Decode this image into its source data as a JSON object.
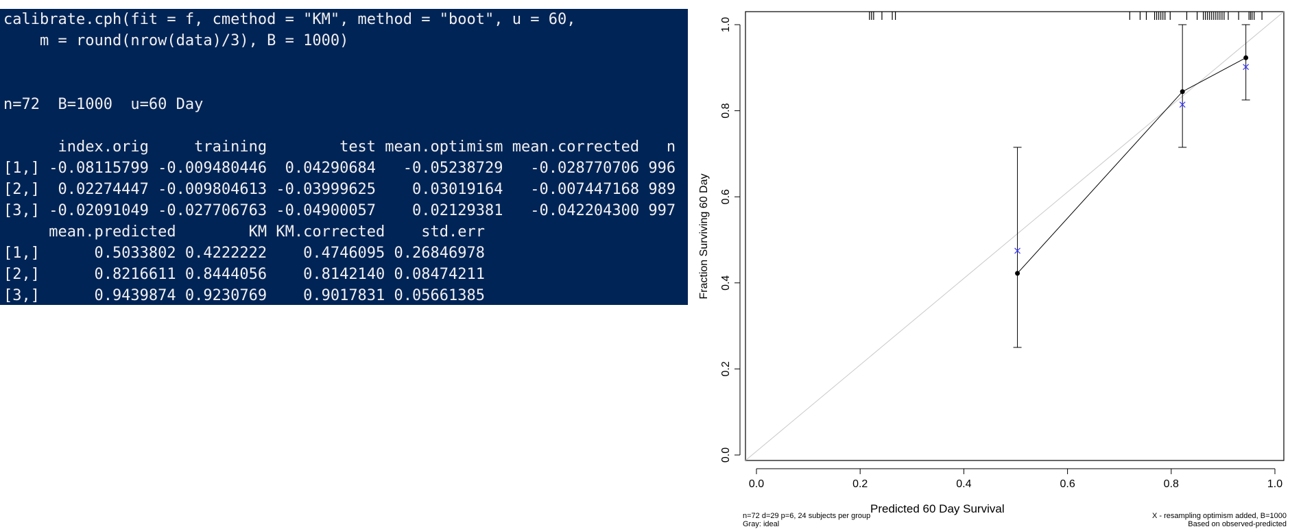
{
  "console": {
    "lines": [
      "calibrate.cph(fit = f, cmethod = \"KM\", method = \"boot\", u = 60,",
      "    m = round(nrow(data)/3), B = 1000)",
      "",
      "",
      "n=72  B=1000  u=60 Day",
      "",
      "      index.orig     training        test mean.optimism mean.corrected   n",
      "[1,] -0.08115799 -0.009480446  0.04290684   -0.05238729   -0.028770706 996",
      "[2,]  0.02274447 -0.009804613 -0.03999625    0.03019164   -0.007447168 989",
      "[3,] -0.02091049 -0.027706763 -0.04900057    0.02129381   -0.042204300 997",
      "     mean.predicted        KM KM.corrected    std.err",
      "[1,]      0.5033802 0.4222222    0.4746095 0.26846978",
      "[2,]      0.8216611 0.8444056    0.8142140 0.08474211",
      "[3,]      0.9439874 0.9230769    0.9017831 0.05661385"
    ]
  },
  "colors": {
    "console_bg": "#012456",
    "console_text": "#f0f0f0",
    "ideal_line": "#c8c8c8",
    "corrected_marker": "#3a3aff",
    "observed": "#000000"
  },
  "chart_data": {
    "type": "scatter",
    "xlabel": "Predicted  60 Day Survival",
    "ylabel": "Fraction Surviving 60 Day",
    "xlim": [
      0,
      1
    ],
    "ylim": [
      0,
      1
    ],
    "xticks": [
      0.0,
      0.2,
      0.4,
      0.6,
      0.8,
      1.0
    ],
    "yticks": [
      0.0,
      0.2,
      0.4,
      0.6,
      0.8,
      1.0
    ],
    "tick_labels": [
      "0.0",
      "0.2",
      "0.4",
      "0.6",
      "0.8",
      "1.0"
    ],
    "grid": false,
    "ideal_line": {
      "x": [
        0,
        1
      ],
      "y": [
        0,
        1
      ]
    },
    "observed": {
      "x": [
        0.5033802,
        0.8216611,
        0.9439874
      ],
      "y": [
        0.4222222,
        0.8444056,
        0.9230769
      ],
      "lower": [
        0.25,
        0.715,
        0.825
      ],
      "upper": [
        0.715,
        1.0,
        1.0
      ]
    },
    "corrected": {
      "x": [
        0.5033802,
        0.8216611,
        0.9439874
      ],
      "y": [
        0.4746095,
        0.814214,
        0.9017831
      ]
    },
    "rug": [
      0.218,
      0.222,
      0.226,
      0.242,
      0.262,
      0.268,
      0.72,
      0.74,
      0.752,
      0.768,
      0.772,
      0.776,
      0.78,
      0.784,
      0.788,
      0.798,
      0.83,
      0.85,
      0.862,
      0.866,
      0.87,
      0.874,
      0.878,
      0.882,
      0.886,
      0.89,
      0.894,
      0.898,
      0.902,
      0.91,
      0.93,
      0.95,
      0.953,
      0.956,
      0.96,
      0.975
    ],
    "footnote_left": [
      "n=72 d=29 p=6, 24 subjects per group",
      "Gray: ideal"
    ],
    "footnote_right": [
      "X - resampling optimism added, B=1000",
      "Based on observed-predicted"
    ]
  }
}
